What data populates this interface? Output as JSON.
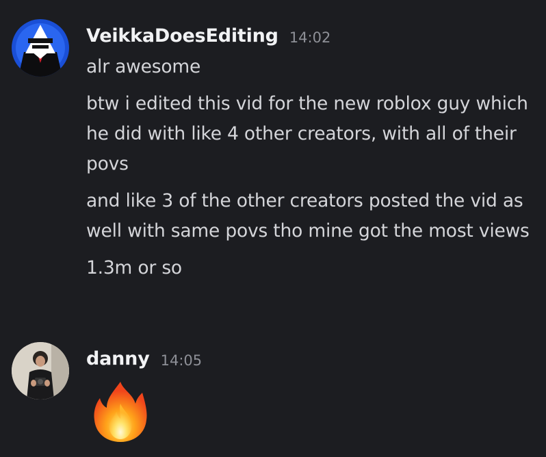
{
  "messages": [
    {
      "username": "VeikkaDoesEditing",
      "time": "14:02",
      "lines": [
        "alr awesome",
        "btw i edited this vid for the new roblox guy which he did with like 4 other creators, with all of their povs",
        "and like 3 of the other creators posted the vid as well with same povs tho mine got the most views",
        "1.3m or so"
      ],
      "avatar_icon": "penguin-avatar-icon"
    },
    {
      "username": "danny",
      "time": "14:05",
      "emoji": "fire-emoji-icon",
      "avatar_icon": "person-photo-avatar-icon"
    }
  ],
  "colors": {
    "background": "#1c1d21",
    "username": "#f1f2f4",
    "text": "#d4d5d9",
    "timestamp": "#8e9097",
    "avatar1_blue": "#1a4fd6"
  }
}
